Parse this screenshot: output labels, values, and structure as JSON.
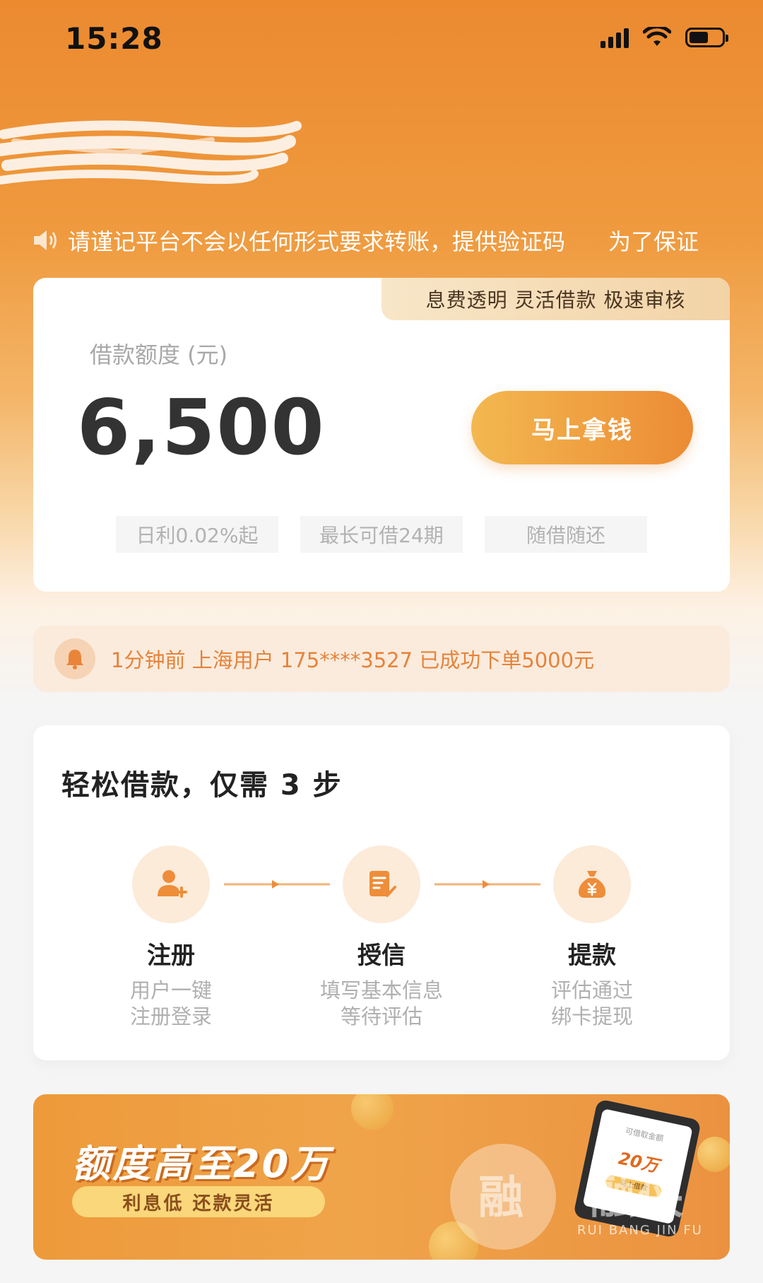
{
  "status_bar": {
    "time": "15:28"
  },
  "notice": {
    "text": "请谨记平台不会以任何形式要求转账，提供验证码      为了保证"
  },
  "loan_card": {
    "tagline": "息费透明 灵活借款 极速审核",
    "limit_label": "借款额度 (元)",
    "amount": "6,500",
    "button": "马上拿钱",
    "features": [
      "日利0.02%起",
      "最长可借24期",
      "随借随还"
    ]
  },
  "activity": {
    "text": "1分钟前 上海用户 175****3527 已成功下单5000元"
  },
  "steps": {
    "title": "轻松借款，仅需 3 步",
    "items": [
      {
        "name": "注册",
        "desc1": "用户一键",
        "desc2": "注册登录",
        "icon": "user-add-icon"
      },
      {
        "name": "授信",
        "desc1": "填写基本信息",
        "desc2": "等待评估",
        "icon": "document-check-icon"
      },
      {
        "name": "提款",
        "desc1": "评估通过",
        "desc2": "绑卡提现",
        "icon": "money-bag-icon"
      }
    ]
  },
  "banner": {
    "title": "额度高至20万",
    "subtitle": "利息低  还款灵活",
    "phone_caption": "可借取金额",
    "phone_amount": "20万",
    "phone_button": "马上借款",
    "watermark": "融",
    "watermark_right": "融侠",
    "watermark_pinyin": "RUI BANG JIN FU"
  },
  "colors": {
    "brand_orange": "#ec8a30",
    "accent_text": "#e5833a",
    "button_start": "#f3b850",
    "button_end": "#ec8b34"
  }
}
